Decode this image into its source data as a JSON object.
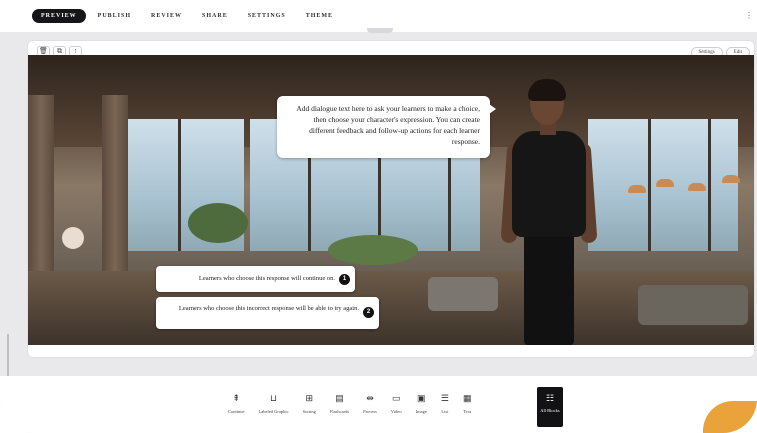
{
  "topnav": {
    "items": [
      "PREVIEW",
      "PUBLISH",
      "REVIEW",
      "SHARE",
      "SETTINGS",
      "THEME"
    ],
    "active": "PREVIEW",
    "more_icon": "more-icon"
  },
  "card": {
    "tools": [
      "trash-icon",
      "copy-icon",
      "arrow-up-icon"
    ],
    "actions": [
      "Settings",
      "Edit"
    ]
  },
  "scenario": {
    "dialogue": "Add dialogue text here to ask your learners to make a choice, then choose your character's expression. You can create different feedback and follow-up actions for each learner response.",
    "responses": [
      {
        "number": "1",
        "text": "Learners who choose this response will continue on."
      },
      {
        "number": "2",
        "text": "Learners who choose this incorrect response will be able to try again."
      }
    ]
  },
  "blocks": {
    "items": [
      {
        "label": "Continue",
        "icon": "continue-icon"
      },
      {
        "label": "Labeled Graphic",
        "icon": "labeled-graphic-icon"
      },
      {
        "label": "Sorting",
        "icon": "sorting-icon"
      },
      {
        "label": "Flashcards",
        "icon": "flashcards-icon"
      },
      {
        "label": "Process",
        "icon": "process-icon"
      },
      {
        "label": "Video",
        "icon": "video-icon"
      },
      {
        "label": "Image",
        "icon": "image-icon"
      },
      {
        "label": "List",
        "icon": "list-icon"
      },
      {
        "label": "Text",
        "icon": "text-icon"
      }
    ],
    "all_blocks_label": "All Blocks"
  },
  "colors": {
    "nav_active_bg": "#16161a",
    "accent": "#e9a33a",
    "frame_bg": "#e9e9eb"
  }
}
